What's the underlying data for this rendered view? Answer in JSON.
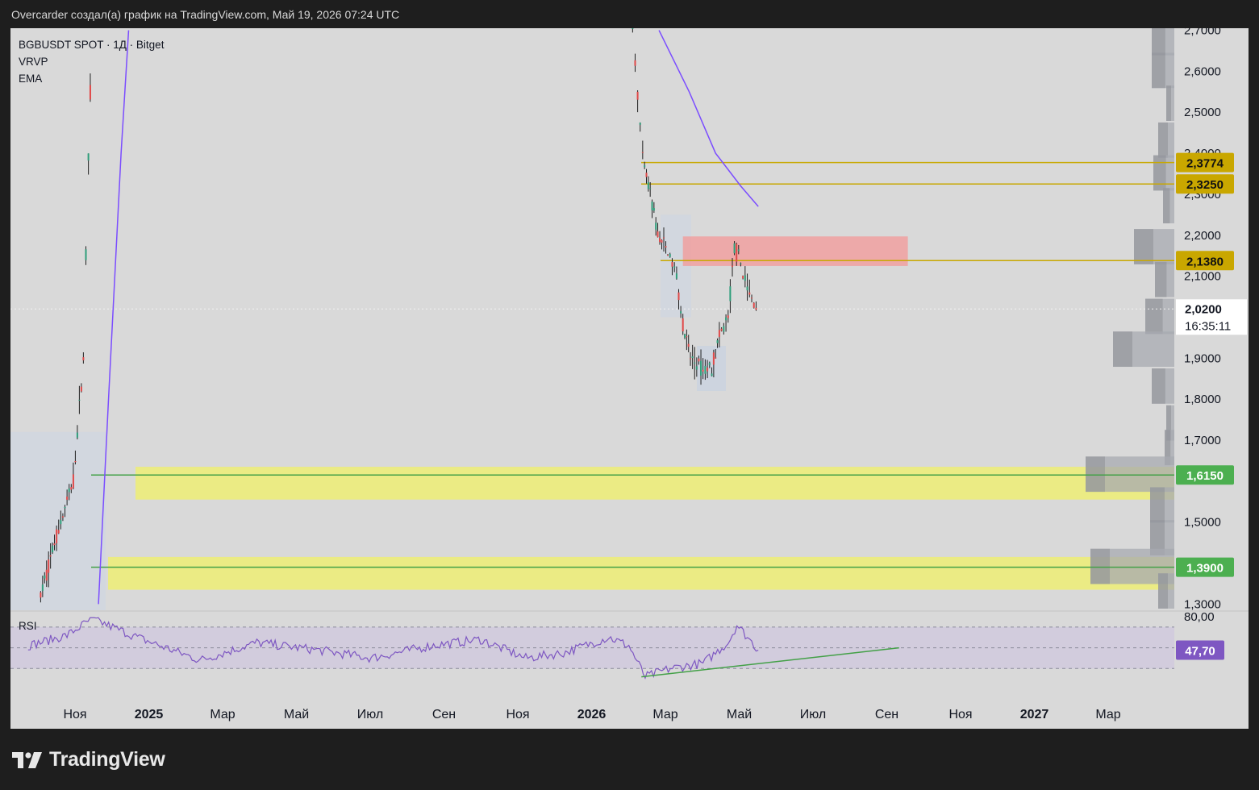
{
  "header": {
    "caption": "Overcarder создал(а) график на TradingView.com, Май 19, 2026 07:24 UTC"
  },
  "legend": {
    "symbol": "BGBUSDT SPOT · 1Д · Bitget",
    "indicator1": "VRVP",
    "indicator2": "EMA"
  },
  "rsi_panel": {
    "label": "RSI"
  },
  "branding": {
    "logo_icon": "tradingview-logo-icon",
    "name": "TradingView"
  },
  "colors": {
    "background": "#d9d9d9",
    "frame": "#1e1e1e",
    "ema": "#7b4dff",
    "rsi": "#7e57c2",
    "level_line": "#c8a800",
    "level_label": "#c9a700",
    "zone_fill": "#ecec7a",
    "support_line": "#43a047",
    "support_label": "#4caf50",
    "supply_zone": "#f0a0a0",
    "candle_up": "#26a69a",
    "candle_down": "#ef5350",
    "volume_profile": "#a7a9b0"
  },
  "chart_data": {
    "type": "candlestick",
    "price_axis": {
      "labels": [
        "2,7000",
        "2,6000",
        "2,5000",
        "2,4000",
        "2,3000",
        "2,2000",
        "2,1000",
        "1,9000",
        "1,8000",
        "1,7000",
        "1,5000",
        "1,4000",
        "1,3000"
      ],
      "values": [
        2.7,
        2.6,
        2.5,
        2.4,
        2.3,
        2.2,
        2.1,
        1.9,
        1.8,
        1.7,
        1.5,
        1.4,
        1.3
      ],
      "range": [
        1.285,
        2.705
      ]
    },
    "time_axis": {
      "labels": [
        "Ноя",
        "2025",
        "Мар",
        "Май",
        "Июл",
        "Сен",
        "Ноя",
        "2026",
        "Мар",
        "Май",
        "Июл",
        "Сен",
        "Ноя",
        "2027",
        "Мар"
      ],
      "bold": [
        false,
        true,
        false,
        false,
        false,
        false,
        false,
        true,
        false,
        false,
        false,
        false,
        false,
        true,
        false
      ]
    },
    "current_price": {
      "label": "2,0200",
      "value": 2.02,
      "countdown": "16:35:11"
    },
    "horizontal_levels": [
      {
        "label": "2,3774",
        "value": 2.3774,
        "style": "yellow"
      },
      {
        "label": "2,3250",
        "value": 2.325,
        "style": "yellow"
      },
      {
        "label": "2,1380",
        "value": 2.138,
        "style": "yellow"
      },
      {
        "label": "1,6150",
        "value": 1.615,
        "style": "green"
      },
      {
        "label": "1,3900",
        "value": 1.39,
        "style": "green"
      }
    ],
    "zones": [
      {
        "kind": "supply",
        "from": 2.125,
        "to": 2.197
      },
      {
        "kind": "highlight",
        "from": 1.555,
        "to": 1.635
      },
      {
        "kind": "highlight",
        "from": 1.335,
        "to": 1.415
      }
    ],
    "ohlc_path": [
      {
        "date": "2024-10-25",
        "price": 1.32
      },
      {
        "date": "2024-11-05",
        "price": 1.45
      },
      {
        "date": "2024-11-20",
        "price": 1.6
      },
      {
        "date": "2024-11-28",
        "price": 1.9
      },
      {
        "date": "2024-12-02",
        "price": 2.4
      },
      {
        "date": "2024-12-05",
        "price": 2.7
      },
      {
        "date": "2026-02-08",
        "price": 2.7
      },
      {
        "date": "2026-02-12",
        "price": 2.55
      },
      {
        "date": "2026-02-16",
        "price": 2.38
      },
      {
        "date": "2026-02-22",
        "price": 2.3
      },
      {
        "date": "2026-02-28",
        "price": 2.2
      },
      {
        "date": "2026-03-08",
        "price": 2.16
      },
      {
        "date": "2026-03-15",
        "price": 2.1
      },
      {
        "date": "2026-03-20",
        "price": 1.98
      },
      {
        "date": "2026-03-26",
        "price": 1.9
      },
      {
        "date": "2026-04-05",
        "price": 1.87
      },
      {
        "date": "2026-04-12",
        "price": 1.88
      },
      {
        "date": "2026-04-18",
        "price": 1.95
      },
      {
        "date": "2026-04-25",
        "price": 2.0
      },
      {
        "date": "2026-04-30",
        "price": 2.17
      },
      {
        "date": "2026-05-05",
        "price": 2.13
      },
      {
        "date": "2026-05-12",
        "price": 2.05
      },
      {
        "date": "2026-05-19",
        "price": 2.02
      }
    ],
    "ema": [
      {
        "date": "2024-12-10",
        "price": 1.3
      },
      {
        "date": "2024-12-18",
        "price": 1.8
      },
      {
        "date": "2024-12-28",
        "price": 2.4
      },
      {
        "date": "2025-01-03",
        "price": 2.7
      },
      {
        "date": "2026-03-01",
        "price": 2.7
      },
      {
        "date": "2026-03-25",
        "price": 2.55
      },
      {
        "date": "2026-04-15",
        "price": 2.4
      },
      {
        "date": "2026-05-05",
        "price": 2.32
      },
      {
        "date": "2026-05-19",
        "price": 2.27
      }
    ],
    "rsi": {
      "axis_label": "80,00",
      "axis_value": 80,
      "current_label": "47,70",
      "current": 47.7,
      "range": [
        10,
        80
      ],
      "bands": [
        70,
        50,
        30
      ],
      "series": [
        {
          "date": "2024-10-15",
          "value": 52
        },
        {
          "date": "2024-11-15",
          "value": 62
        },
        {
          "date": "2024-12-05",
          "value": 78
        },
        {
          "date": "2025-01-10",
          "value": 60
        },
        {
          "date": "2025-03-01",
          "value": 38
        },
        {
          "date": "2025-04-15",
          "value": 55
        },
        {
          "date": "2025-06-01",
          "value": 48
        },
        {
          "date": "2025-07-15",
          "value": 40
        },
        {
          "date": "2025-09-01",
          "value": 52
        },
        {
          "date": "2025-10-10",
          "value": 58
        },
        {
          "date": "2025-11-15",
          "value": 40
        },
        {
          "date": "2025-12-15",
          "value": 45
        },
        {
          "date": "2026-01-20",
          "value": 60
        },
        {
          "date": "2026-02-05",
          "value": 52
        },
        {
          "date": "2026-02-18",
          "value": 22
        },
        {
          "date": "2026-03-10",
          "value": 30
        },
        {
          "date": "2026-04-05",
          "value": 35
        },
        {
          "date": "2026-04-25",
          "value": 55
        },
        {
          "date": "2026-05-02",
          "value": 72
        },
        {
          "date": "2026-05-12",
          "value": 58
        },
        {
          "date": "2026-05-19",
          "value": 47.7
        }
      ],
      "trendline": [
        {
          "date": "2026-02-15",
          "value": 22
        },
        {
          "date": "2026-09-08",
          "value": 50
        }
      ]
    }
  }
}
